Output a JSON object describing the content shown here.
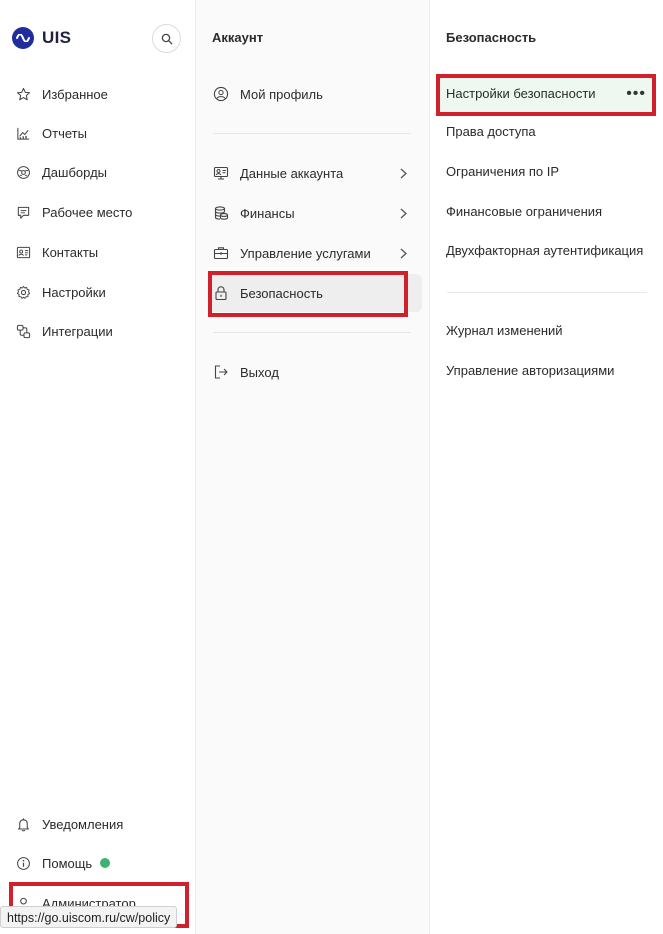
{
  "app": {
    "logo_text": "UIS",
    "brand_color": "#1f2d9e"
  },
  "sidebar": {
    "items": [
      {
        "label": "Избранное",
        "icon": "star-icon"
      },
      {
        "label": "Отчеты",
        "icon": "chart-icon"
      },
      {
        "label": "Дашборды",
        "icon": "dashboard-icon"
      },
      {
        "label": "Рабочее место",
        "icon": "chat-icon"
      },
      {
        "label": "Контакты",
        "icon": "contacts-icon"
      },
      {
        "label": "Настройки",
        "icon": "gear-icon"
      },
      {
        "label": "Интеграции",
        "icon": "integration-icon"
      }
    ],
    "bottom": [
      {
        "label": "Уведомления",
        "icon": "bell-icon"
      },
      {
        "label": "Помощь",
        "icon": "info-icon",
        "status_color": "#3cb371"
      },
      {
        "label": "Администратор",
        "icon": "user-icon"
      }
    ]
  },
  "account_menu": {
    "title": "Аккаунт",
    "items": [
      {
        "label": "Мой профиль",
        "icon": "profile-icon"
      },
      {
        "label": "Данные аккаунта",
        "icon": "account-data-icon"
      },
      {
        "label": "Финансы",
        "icon": "coins-icon"
      },
      {
        "label": "Управление услугами",
        "icon": "briefcase-icon"
      },
      {
        "label": "Безопасность",
        "icon": "lock-icon"
      },
      {
        "label": "Выход",
        "icon": "logout-icon"
      }
    ]
  },
  "security_menu": {
    "title": "Безопасность",
    "items": [
      "Настройки безопасности",
      "Права доступа",
      "Ограничения по IP",
      "Финансовые ограничения",
      "Двухфакторная аутентификация",
      "Журнал изменений",
      "Управление авторизациями"
    ],
    "more_glyph": "•••"
  },
  "status_bar": {
    "url": "https://go.uiscom.ru/cw/policy"
  },
  "colors": {
    "highlight": "#d0202b",
    "active_bg": "#eef8f1"
  }
}
